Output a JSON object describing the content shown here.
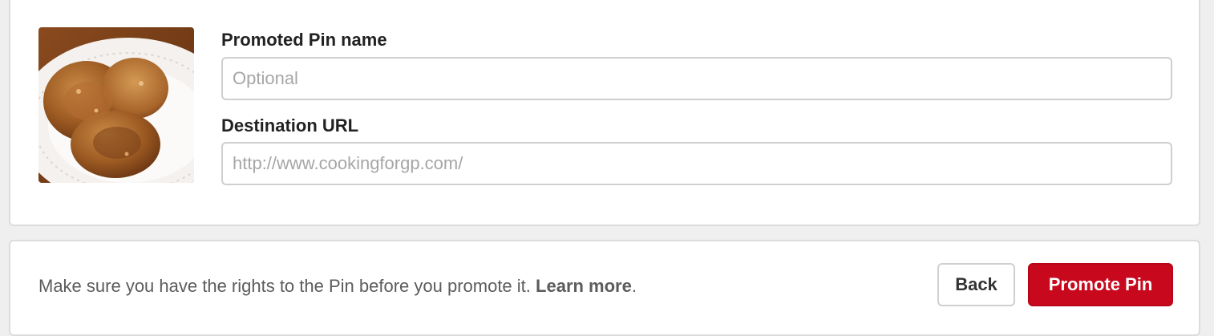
{
  "pin": {
    "image": "pancakes-on-plate",
    "name_label": "Promoted Pin name",
    "name_value": "",
    "name_placeholder": "Optional",
    "url_label": "Destination URL",
    "url_value": "",
    "url_placeholder": "http://www.cookingforgp.com/"
  },
  "footer": {
    "disclaimer": "Make sure you have the rights to the Pin before you promote it.",
    "learn_more": "Learn more",
    "period": ".",
    "back_label": "Back",
    "promote_label": "Promote Pin"
  },
  "colors": {
    "primary": "#c8081c",
    "border": "#cfcfcf",
    "background": "#efefef"
  }
}
